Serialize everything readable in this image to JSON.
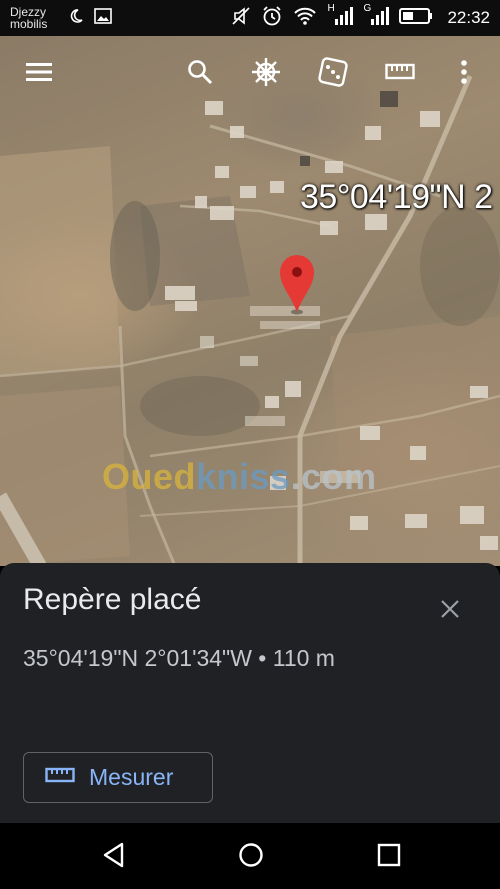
{
  "status_bar": {
    "carrier_line1": "Djezzy",
    "carrier_line2": "mobilis",
    "time": "22:32",
    "signal1_tag": "H",
    "signal2_tag": "G"
  },
  "toolbar": {
    "icons": [
      "menu-icon",
      "search-icon",
      "ship-wheel-icon",
      "dice-icon",
      "ruler-icon",
      "more-vert-icon"
    ]
  },
  "map": {
    "coordinate_overlay": "35°04'19\"N 2",
    "watermark": {
      "part1": "Oued",
      "part2": "kniss",
      "part3": ".com"
    },
    "marker_color": "#e53935"
  },
  "sheet": {
    "title": "Repère placé",
    "coordinates": "35°04'19\"N 2°01'34\"W • 110 m",
    "measure_label": "Mesurer",
    "accent": "#8ab4f8"
  },
  "nav_bar": {
    "icons": [
      "back-icon",
      "home-icon",
      "recents-icon"
    ]
  }
}
